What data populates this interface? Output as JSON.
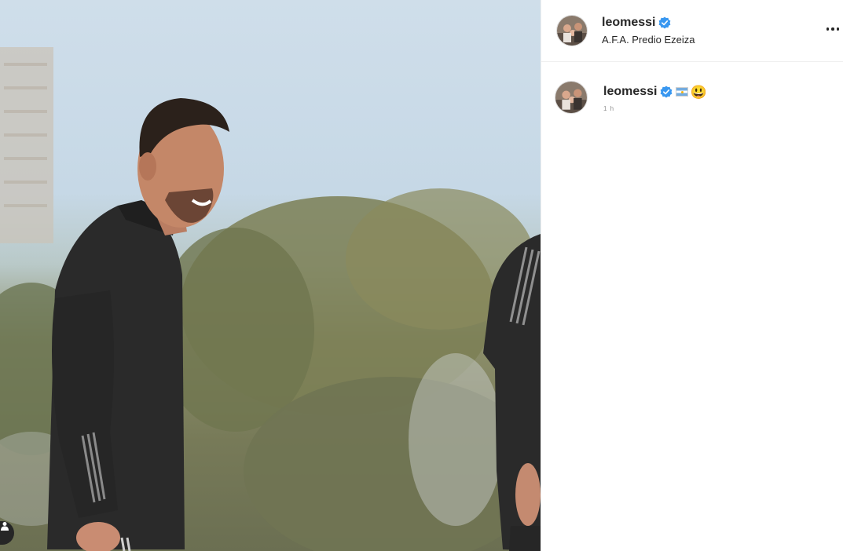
{
  "post": {
    "username": "leomessi",
    "location": "A.F.A. Predio Ezeiza",
    "verified": true
  },
  "comment": {
    "username": "leomessi",
    "caption_emojis": [
      "argentina-flag",
      "😃"
    ],
    "smile": "😃",
    "time_label": "1 h"
  },
  "colors": {
    "verified": "#3897f0",
    "text": "#262626",
    "muted": "#8e8e8e",
    "border": "#efefef"
  }
}
